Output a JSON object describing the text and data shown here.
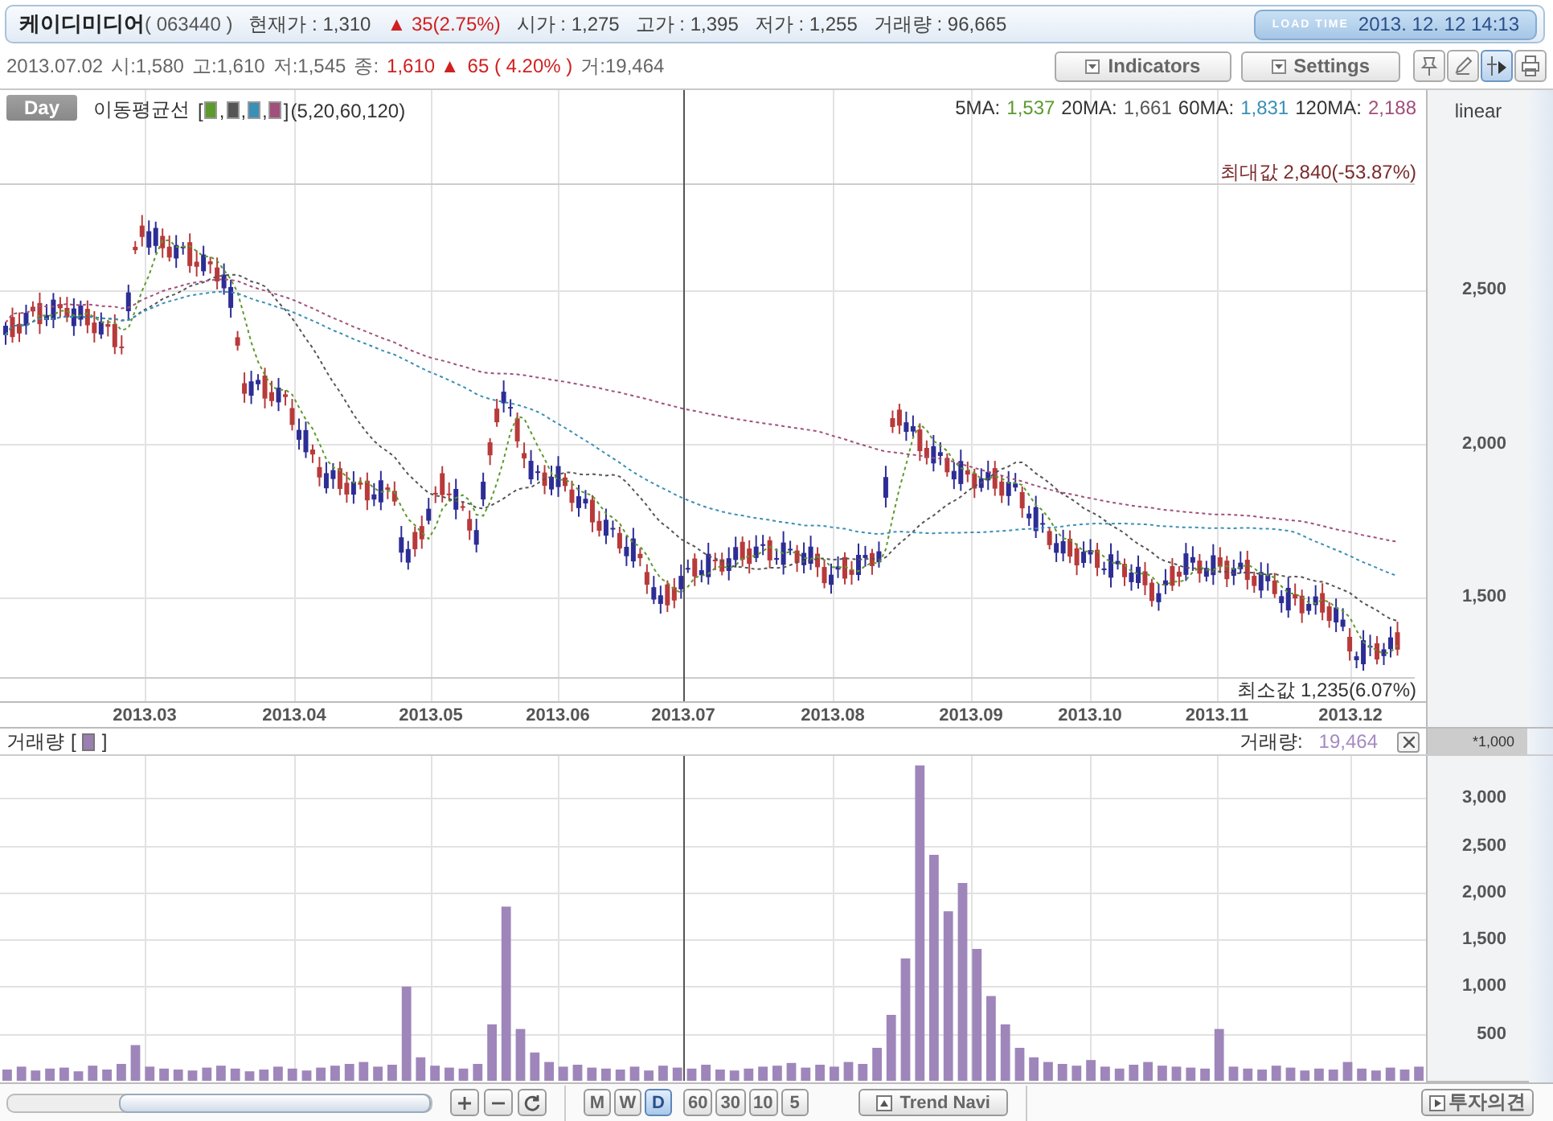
{
  "header": {
    "name": "케이디미디어",
    "code": "( 063440 )",
    "quotes": [
      {
        "text": "현재가 : 1,310",
        "kind": "plain"
      },
      {
        "text": "▲ 35(2.75%)",
        "kind": "up"
      },
      {
        "text": "시가 : 1,275",
        "kind": "plain"
      },
      {
        "text": "고가 : 1,395",
        "kind": "plain"
      },
      {
        "text": "저가 : 1,255",
        "kind": "plain"
      },
      {
        "text": "거래량 : 96,665",
        "kind": "plain"
      }
    ],
    "load_time": {
      "label": "LOAD TIME",
      "value": "2013. 12. 12 14:13"
    }
  },
  "info_bar": {
    "items": [
      {
        "text": "2013.07.02",
        "kind": "plain"
      },
      {
        "text": "시:1,580",
        "kind": "plain"
      },
      {
        "text": "고:1,610",
        "kind": "plain"
      },
      {
        "text": "저:1,545",
        "kind": "plain"
      },
      {
        "text": "종:",
        "kind": "plain"
      },
      {
        "text": "1,610 ▲",
        "kind": "up"
      },
      {
        "text": "65 (  4.20% )",
        "kind": "up"
      },
      {
        "text": "거:19,464",
        "kind": "plain"
      }
    ]
  },
  "toolbar": {
    "buttons": [
      {
        "label": "Indicators"
      },
      {
        "label": "Settings"
      }
    ],
    "tools": [
      {
        "kind": "pin",
        "selected": false
      },
      {
        "kind": "pencil",
        "selected": false
      },
      {
        "kind": "cursor",
        "selected": true
      },
      {
        "kind": "print",
        "selected": false
      }
    ]
  },
  "price_chart": {
    "period": "Day",
    "indicator": "이동평균선",
    "legend": {
      "open": "[",
      "separator": ",",
      "close": "]"
    },
    "ma_params": "(5,20,60,120)",
    "moving_averages": [
      {
        "label": "5MA:",
        "value": "1,537",
        "color": "#5c9a2e"
      },
      {
        "label": "20MA:",
        "value": "1,661",
        "color": "#555555"
      },
      {
        "label": "60MA:",
        "value": "1,831",
        "color": "#3a8fb7"
      },
      {
        "label": "120MA:",
        "value": "2,188",
        "color": "#a0507a"
      }
    ],
    "scale": "linear",
    "yticks": [
      "2,500",
      "2,000",
      "1,500"
    ],
    "max_label": "최대값 2,840(-53.87%)",
    "min_label": "최소값 1,235(6.07%)",
    "xlabels": [
      "2013.03",
      "2013.04",
      "2013.05",
      "2013.06",
      "2013.07",
      "2013.08",
      "2013.09",
      "2013.10",
      "2013.11",
      "2013.12"
    ]
  },
  "volume_chart": {
    "label": "거래량",
    "legend": {
      "open": "[",
      "close": "]"
    },
    "reading_label": "거래량:",
    "reading": "19,464",
    "unit": "*1,000",
    "chart_data": {
      "type": "bar",
      "grid": true,
      "ylim": [
        0,
        3450
      ],
      "yticks": [
        {
          "value": 500,
          "label": "500"
        },
        {
          "value": 1000,
          "label": "1,000"
        },
        {
          "value": 1500,
          "label": "1,500"
        },
        {
          "value": 2000,
          "label": "2,000"
        },
        {
          "value": 2500,
          "label": "2,500"
        },
        {
          "value": 3000,
          "label": "3,000"
        }
      ],
      "values": [
        120,
        150,
        110,
        130,
        140,
        100,
        160,
        120,
        180,
        380,
        150,
        130,
        120,
        110,
        140,
        160,
        130,
        100,
        120,
        150,
        130,
        110,
        140,
        160,
        180,
        200,
        150,
        170,
        1000,
        250,
        160,
        140,
        130,
        180,
        600,
        1850,
        550,
        300,
        200,
        150,
        170,
        140,
        130,
        120,
        150,
        110,
        160,
        140,
        130,
        170,
        120,
        110,
        130,
        150,
        160,
        190,
        140,
        170,
        150,
        200,
        180,
        350,
        700,
        1300,
        3350,
        2400,
        1800,
        2100,
        1400,
        900,
        600,
        350,
        250,
        200,
        180,
        160,
        220,
        150,
        130,
        170,
        200,
        160,
        150,
        140,
        130,
        550,
        150,
        130,
        120,
        160,
        140,
        110,
        130,
        120,
        200,
        130,
        110,
        140,
        120,
        150
      ]
    }
  },
  "bottom_bar": {
    "zoom_range": {
      "level": 0.73
    },
    "periods": [
      {
        "label": "M",
        "selected": false
      },
      {
        "label": "W",
        "selected": false
      },
      {
        "label": "D",
        "selected": true
      }
    ],
    "intervals": [
      {
        "label": "60",
        "selected": false
      },
      {
        "label": "30",
        "selected": false
      },
      {
        "label": "10",
        "selected": false
      },
      {
        "label": "5",
        "selected": false
      }
    ],
    "trend_button": "Trend Navi",
    "opinion_button": "투자의견"
  }
}
